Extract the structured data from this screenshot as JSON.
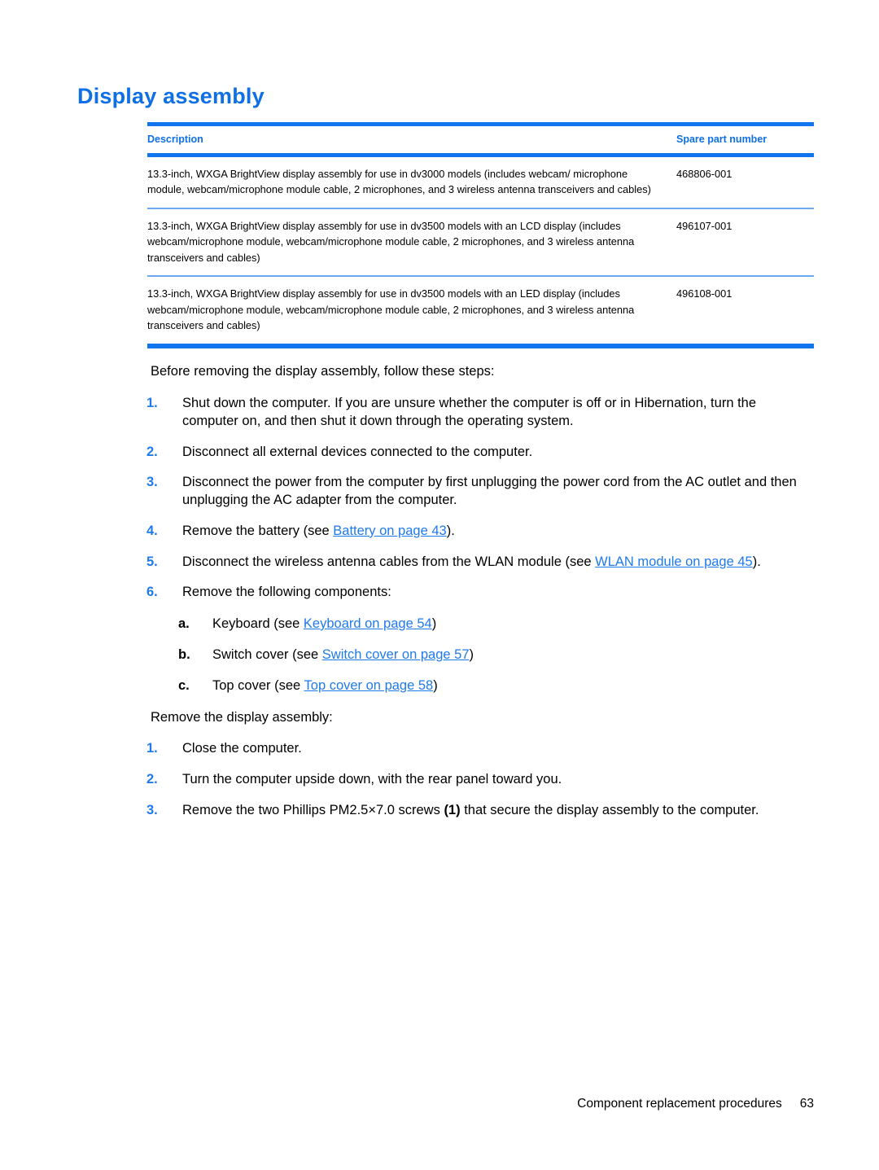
{
  "document": {
    "title": "Display assembly",
    "accent_color": "#0f6fe5",
    "link_color": "#1f7aec",
    "table_rule_color": "#1176ee"
  },
  "spec_table": {
    "columns": [
      "Description",
      "Spare part number"
    ],
    "rows": [
      {
        "description": "13.3-inch, WXGA BrightView display assembly for use in dv3000 models (includes webcam/ microphone module, webcam/microphone module cable, 2 microphones, and 3 wireless antenna transceivers and cables)",
        "spare_part_number": "468806-001"
      },
      {
        "description": "13.3-inch, WXGA BrightView display assembly for use in dv3500 models with an LCD display (includes webcam/microphone module, webcam/microphone module cable, 2 microphones, and 3 wireless antenna transceivers and cables)",
        "spare_part_number": "496107-001"
      },
      {
        "description": "13.3-inch, WXGA BrightView display assembly for use in dv3500 models with an LED display (includes webcam/microphone module, webcam/microphone module cable, 2 microphones, and 3 wireless antenna transceivers and cables)",
        "spare_part_number": "496108-001"
      }
    ]
  },
  "before_section": {
    "intro": "Before removing the display assembly, follow these steps:",
    "steps": [
      {
        "marker": "1.",
        "text": "Shut down the computer. If you are unsure whether the computer is off or in Hibernation, turn the computer on, and then shut it down through the operating system."
      },
      {
        "marker": "2.",
        "text": "Disconnect all external devices connected to the computer."
      },
      {
        "marker": "3.",
        "text": "Disconnect the power from the computer by first unplugging the power cord from the AC outlet and then unplugging the AC adapter from the computer."
      },
      {
        "marker": "4.",
        "prefix": "Remove the battery (see ",
        "link": "Battery on page 43",
        "suffix": ")."
      },
      {
        "marker": "5.",
        "prefix": "Disconnect the wireless antenna cables from the WLAN module (see ",
        "link": "WLAN module on page 45",
        "suffix": ")."
      },
      {
        "marker": "6.",
        "text": "Remove the following components:"
      }
    ],
    "substeps": [
      {
        "marker": "a.",
        "prefix": "Keyboard (see ",
        "link": "Keyboard on page 54",
        "suffix": ")"
      },
      {
        "marker": "b.",
        "prefix": "Switch cover (see ",
        "link": "Switch cover on page 57",
        "suffix": ")"
      },
      {
        "marker": "c.",
        "prefix": "Top cover (see ",
        "link": "Top cover on page 58",
        "suffix": ")"
      }
    ]
  },
  "remove_section": {
    "intro": "Remove the display assembly:",
    "steps": [
      {
        "marker": "1.",
        "text": "Close the computer."
      },
      {
        "marker": "2.",
        "text": "Turn the computer upside down, with the rear panel toward you."
      },
      {
        "marker": "3.",
        "prefix": "Remove the two Phillips PM2.5×7.0 screws ",
        "bold": "(1)",
        "suffix": " that secure the display assembly to the computer."
      }
    ]
  },
  "footer": {
    "chapter": "Component replacement procedures",
    "page_number": "63"
  }
}
